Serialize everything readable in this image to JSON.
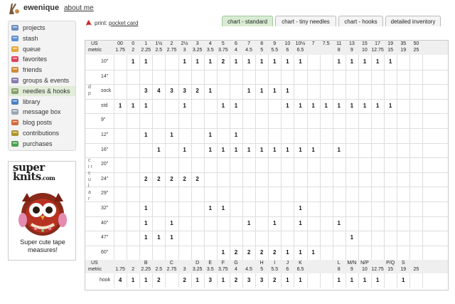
{
  "header": {
    "username": "ewenique",
    "about_link": "about me"
  },
  "sidebar": {
    "items": [
      {
        "label": "projects",
        "icon": "projects-icon",
        "color": "#6b8fbf",
        "active": false
      },
      {
        "label": "stash",
        "icon": "stash-icon",
        "color": "#5e8fd0",
        "active": false
      },
      {
        "label": "queue",
        "icon": "queue-icon",
        "color": "#e5a837",
        "active": false
      },
      {
        "label": "favorites",
        "icon": "heart-icon",
        "color": "#e0405a",
        "active": false
      },
      {
        "label": "friends",
        "icon": "friends-icon",
        "color": "#d08a3a",
        "active": false
      },
      {
        "label": "groups & events",
        "icon": "groups-icon",
        "color": "#8a7ab0",
        "active": false
      },
      {
        "label": "needles & hooks",
        "icon": "needles-icon",
        "color": "#8aa06a",
        "active": true
      },
      {
        "label": "library",
        "icon": "library-icon",
        "color": "#4a7fc0",
        "active": false
      },
      {
        "label": "message box",
        "icon": "mail-icon",
        "color": "#9aa4b4",
        "active": false
      },
      {
        "label": "blog posts",
        "icon": "blog-icon",
        "color": "#d46a3a",
        "active": false
      },
      {
        "label": "contributions",
        "icon": "contributions-icon",
        "color": "#b0952c",
        "active": false
      },
      {
        "label": "purchases",
        "icon": "purchases-icon",
        "color": "#4da050",
        "active": false
      }
    ]
  },
  "ad": {
    "logo_text": "super knits",
    "logo_sub": ".com",
    "caption": "Super cute tape measures!"
  },
  "toolbar": {
    "print_prefix": "print:",
    "print_link": "pocket card"
  },
  "tabs": [
    {
      "label": "chart - standard",
      "active": true
    },
    {
      "label": "chart - tiny needles",
      "active": false
    },
    {
      "label": "chart - hooks",
      "active": false
    },
    {
      "label": "detailed inventory",
      "active": false
    }
  ],
  "chart": {
    "us_label": "US",
    "metric_label": "metric",
    "us_sizes": [
      "00",
      "0",
      "1",
      "1½",
      "2",
      "2½",
      "3",
      "4",
      "5",
      "6",
      "7",
      "8",
      "9",
      "10",
      "10½",
      "7",
      "7.5",
      "11",
      "13",
      "15",
      "17",
      "19",
      "35",
      "50"
    ],
    "metric_sizes": [
      "1.75",
      "2",
      "2.25",
      "2.5",
      "2.75",
      "3",
      "3.25",
      "3.5",
      "3.75",
      "4",
      "4.5",
      "5",
      "5.5",
      "6",
      "6.5",
      "",
      "",
      "8",
      "9",
      "10",
      "12.75",
      "15",
      "19",
      "25"
    ],
    "section_labels": {
      "dp": "d p",
      "circular": "c i r c u l a r"
    },
    "rows": [
      {
        "label": "10\"",
        "cells": {
          "1": "1",
          "2": "1",
          "5": "1",
          "6": "1",
          "7": "1",
          "8": "2",
          "9": "1",
          "10": "1",
          "11": "1",
          "12": "1",
          "13": "1",
          "14": "1",
          "17": "1",
          "18": "1",
          "19": "1",
          "20": "1",
          "21": "1"
        }
      },
      {
        "label": "14\"",
        "cells": {}
      },
      {
        "label": "sock",
        "cells": {
          "2": "3",
          "3": "4",
          "4": "3",
          "5": "3",
          "6": "2",
          "7": "1",
          "10": "1",
          "11": "1",
          "12": "1",
          "13": "1"
        }
      },
      {
        "label": "std",
        "cells": {
          "0": "1",
          "1": "1",
          "2": "1",
          "5": "1",
          "8": "1",
          "9": "1",
          "13": "1",
          "14": "1",
          "15": "1",
          "16": "1",
          "17": "1",
          "18": "1",
          "19": "1",
          "20": "1",
          "21": "1"
        }
      },
      {
        "label": "9\"",
        "cells": {}
      },
      {
        "label": "12\"",
        "cells": {
          "2": "1",
          "4": "1",
          "7": "1",
          "9": "1"
        }
      },
      {
        "label": "16\"",
        "cells": {
          "3": "1",
          "5": "1",
          "7": "1",
          "8": "1",
          "9": "1",
          "10": "1",
          "11": "1",
          "12": "1",
          "13": "1",
          "14": "1",
          "15": "1",
          "17": "1"
        }
      },
      {
        "label": "20\"",
        "cells": {}
      },
      {
        "label": "24\"",
        "cells": {
          "2": "2",
          "3": "2",
          "4": "2",
          "5": "2",
          "6": "2"
        }
      },
      {
        "label": "29\"",
        "cells": {}
      },
      {
        "label": "32\"",
        "cells": {
          "2": "1",
          "7": "1",
          "8": "1",
          "14": "1"
        }
      },
      {
        "label": "40\"",
        "cells": {
          "2": "1",
          "4": "1",
          "10": "1",
          "12": "1",
          "14": "1",
          "17": "1"
        }
      },
      {
        "label": "47\"",
        "cells": {
          "2": "1",
          "3": "1",
          "4": "1",
          "18": "1"
        }
      },
      {
        "label": "60\"",
        "cells": {
          "8": "1",
          "9": "2",
          "10": "2",
          "11": "2",
          "12": "2",
          "13": "1",
          "14": "1",
          "15": "1"
        }
      }
    ],
    "hook_header": {
      "us_letters": [
        "",
        "",
        "B",
        "",
        "C",
        "",
        "D",
        "E",
        "F",
        "G",
        "",
        "H",
        "I",
        "J",
        "K",
        "",
        "",
        "L",
        "M/N",
        "N/P",
        "",
        "P/Q",
        "S",
        ""
      ],
      "metric": [
        "1.75",
        "2",
        "2.25",
        "2.5",
        "2.75",
        "3",
        "3.25",
        "3.5",
        "3.75",
        "4",
        "4.5",
        "5",
        "5.5",
        "6",
        "6.5",
        "",
        "",
        "8",
        "9",
        "10",
        "12.75",
        "15",
        "19",
        "25"
      ]
    },
    "hook_row": {
      "label": "hook",
      "cells": {
        "0": "4",
        "1": "1",
        "2": "1",
        "3": "2",
        "5": "2",
        "6": "1",
        "7": "3",
        "8": "1",
        "9": "2",
        "10": "3",
        "11": "3",
        "12": "2",
        "13": "1",
        "14": "1",
        "17": "1",
        "18": "1",
        "19": "1",
        "20": "1",
        "22": "1"
      }
    }
  }
}
